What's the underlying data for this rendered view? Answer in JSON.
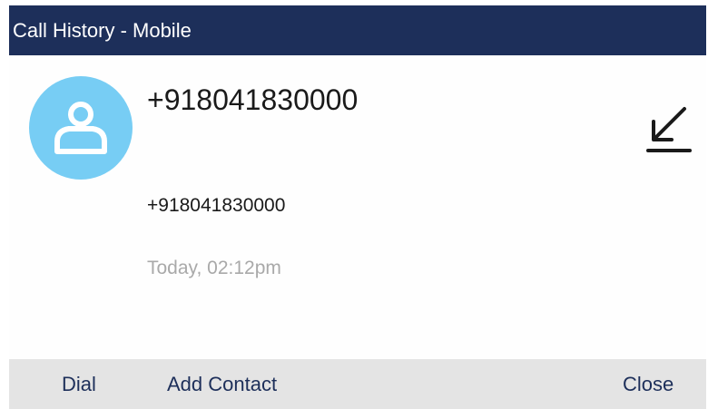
{
  "header": {
    "title": "Call History - Mobile"
  },
  "contact": {
    "name": "+918041830000",
    "number": "+918041830000",
    "timestamp": "Today, 02:12pm",
    "avatar_icon": "person-icon",
    "direction_icon": "incoming-call-arrow-icon"
  },
  "softkeys": {
    "dial": "Dial",
    "add_contact": "Add Contact",
    "close": "Close"
  },
  "colors": {
    "title_bar": "#1d2f5a",
    "avatar": "#77cdf4",
    "softkey_bar": "#e4e4e4",
    "timestamp": "#a9a9a9"
  }
}
